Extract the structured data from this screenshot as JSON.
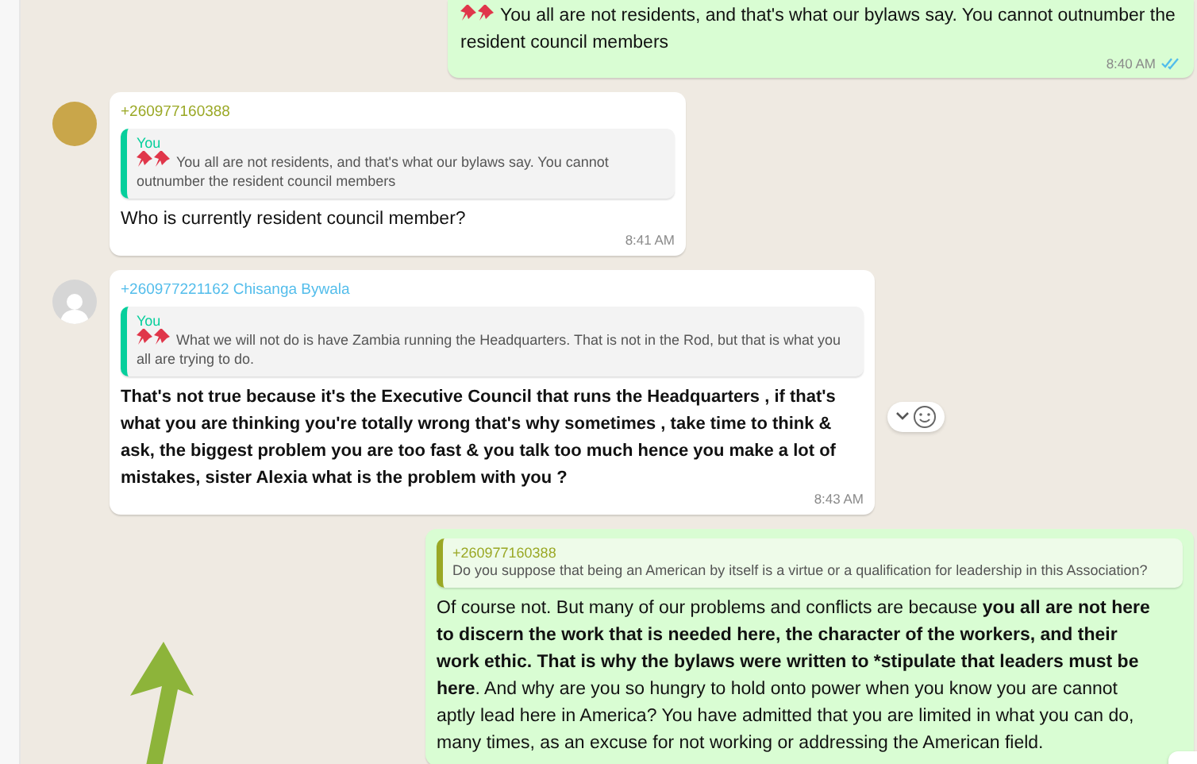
{
  "messages": [
    {
      "kind": "outgoing",
      "pinned": true,
      "text": "You all are not residents, and that's what our bylaws say. You cannot outnumber the resident council members",
      "bold": false,
      "time": "8:40 AM",
      "read": true,
      "hover": false
    },
    {
      "kind": "incoming",
      "has_photo": true,
      "sender": "+260977160388",
      "color": "#9aa825",
      "quote": {
        "author": "You",
        "color": "#06cf9c",
        "pinned": true,
        "text": "You all are not residents, and that's what our bylaws say. You cannot outnumber the resident council members"
      },
      "text": "Who is currently resident council member?",
      "bold": false,
      "time": "8:41 AM",
      "hover": false
    },
    {
      "kind": "incoming",
      "has_photo": false,
      "sender": "+260977221162 Chisanga Bywala",
      "color": "#53bdeb",
      "quote": {
        "author": "You",
        "color": "#06cf9c",
        "pinned": true,
        "text": "What we will not do is have Zambia running the Headquarters. That is not in the Rod, but that is what you all are trying to do."
      },
      "text": "That's not true because it's the Executive Council that runs the Headquarters , if that's what you are thinking you're totally wrong that's why sometimes , take time to think & ask,  the biggest problem you are too fast & you talk too much hence you  make a lot of mistakes,  sister Alexia what is the problem with you ?",
      "bold": true,
      "time": "8:43 AM",
      "hover": true
    },
    {
      "kind": "outgoing",
      "quote": {
        "author": "+260977160388",
        "color": "#9aa825",
        "pinned": false,
        "text": "Do you suppose that being an American by itself is a virtue or a qualification for leadership in this Association?"
      },
      "text": "Of course not. But many of our problems and conflicts are because **you all are not here to discern the work that is needed here, the character of the workers, and their work ethic. That is why the bylaws were written to *stipulate that leaders must be here**. And why are you so hungry to hold onto power when you know you are cannot aptly lead here in America? You have admitted that you are limited in what you can do, many times, as an excuse for not working or addressing the American field.",
      "bold": false,
      "hover": false
    }
  ]
}
